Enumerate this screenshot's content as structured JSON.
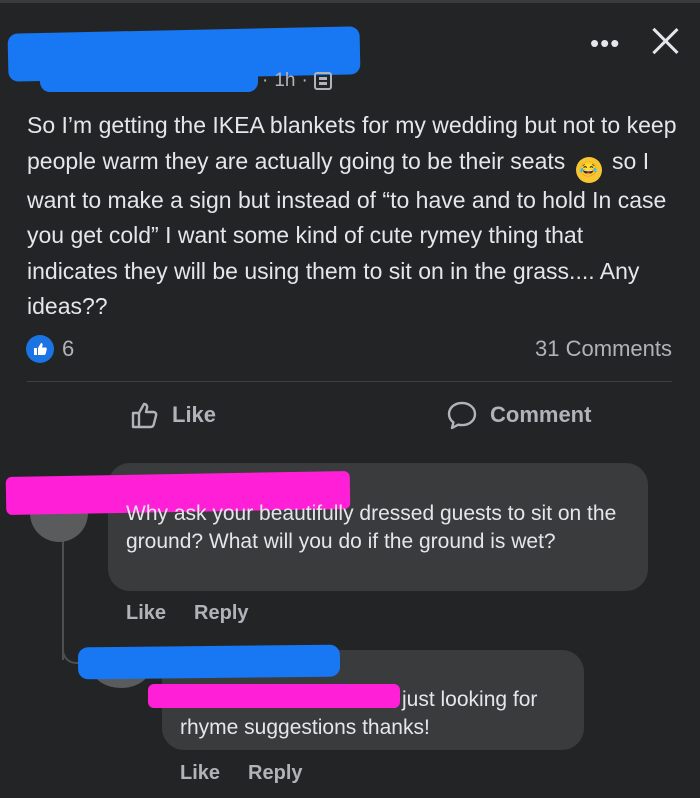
{
  "post": {
    "time": "1h",
    "separator_before": "·",
    "separator_after": "·",
    "more_icon": "more-dots-icon",
    "close_icon": "close-icon",
    "text_part1": "So I’m getting the IKEA blankets for my wedding but not to keep people warm they are actually going to be their seats",
    "text_part2": "so I want to make a sign but instead of “to have and to hold In case you get cold” I want some kind of cute rymey thing that indicates they will be using them to sit on in the grass.... Any ideas??",
    "emoji": "rolling-on-floor-laughing-emoji",
    "like_count": "6",
    "comment_count": "31 Comments",
    "actions": {
      "like": "Like",
      "comment": "Comment"
    }
  },
  "comments": [
    {
      "text": "Why ask your beautifully dressed guests to sit on the ground? What will you do if the ground is wet?",
      "actions": [
        "Like",
        "Reply"
      ]
    },
    {
      "text": "just looking for rhyme suggestions thanks!",
      "actions": [
        "Like",
        "Reply"
      ]
    }
  ],
  "colors": {
    "background": "#232425",
    "bubble": "#3a3b3c",
    "text": "#e4e6eb",
    "muted": "#b0b3b8",
    "accent": "#1b74e4",
    "redact_blue": "#1877f2",
    "redact_pink": "#ff1fd6"
  }
}
